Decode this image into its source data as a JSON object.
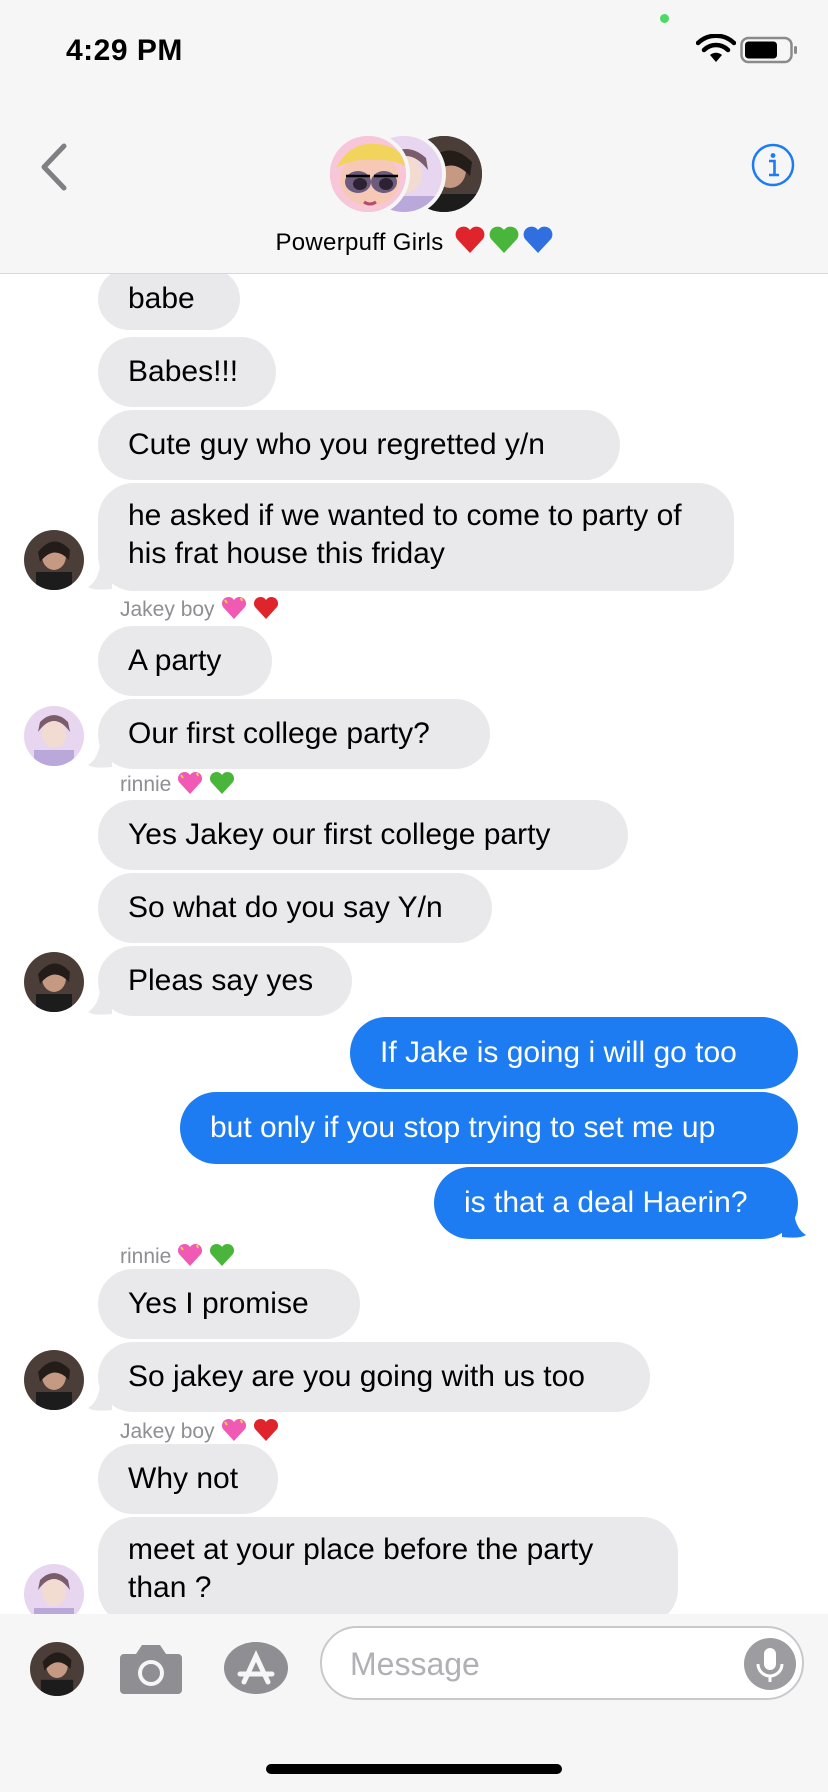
{
  "status_bar": {
    "time": "4:29 PM"
  },
  "header": {
    "group_name": "Powerpuff Girls",
    "back_icon": "chevron-left-icon",
    "info_icon": "info-circle-icon",
    "hearts": [
      "red-heart",
      "green-heart",
      "blue-heart"
    ]
  },
  "colors": {
    "outgoing_bubble": "#1d7cf2",
    "incoming_bubble": "#e9e9eb",
    "accent": "#1d7cf2",
    "sender_label": "#8e8e93"
  },
  "messages": [
    {
      "direction": "in",
      "text": "babe"
    },
    {
      "direction": "in",
      "text": "Babes!!!"
    },
    {
      "direction": "in",
      "text": "Cute guy who you regretted y/n"
    },
    {
      "direction": "in",
      "text": "he asked if we wanted to come to party of his frat house this friday"
    },
    {
      "sender": "Jakey boy",
      "sender_hearts": [
        "sparkling-heart",
        "red-heart"
      ]
    },
    {
      "direction": "in",
      "text": "A party"
    },
    {
      "direction": "in",
      "text": "Our first college party?"
    },
    {
      "sender": "rinnie",
      "sender_hearts": [
        "sparkling-heart",
        "green-heart"
      ]
    },
    {
      "direction": "in",
      "text": "Yes Jakey our first college party"
    },
    {
      "direction": "in",
      "text": "So what do you say Y/n"
    },
    {
      "direction": "in",
      "text": "Pleas say yes"
    },
    {
      "direction": "out",
      "text": "If Jake is going i will go too"
    },
    {
      "direction": "out",
      "text": "but only if you stop trying to set me up"
    },
    {
      "direction": "out",
      "text": "is that a deal Haerin?"
    },
    {
      "sender": "rinnie",
      "sender_hearts": [
        "sparkling-heart",
        "green-heart"
      ]
    },
    {
      "direction": "in",
      "text": "Yes I promise"
    },
    {
      "direction": "in",
      "text": "So jakey are you going with us too"
    },
    {
      "sender": "Jakey boy",
      "sender_hearts": [
        "sparkling-heart",
        "red-heart"
      ]
    },
    {
      "direction": "in",
      "text": "Why not"
    },
    {
      "direction": "in",
      "text": "meet at your place before the party than ?"
    }
  ],
  "compose": {
    "placeholder": "Message",
    "camera_icon": "camera-icon",
    "appstore_icon": "app-store-icon",
    "mic_icon": "microphone-icon"
  }
}
